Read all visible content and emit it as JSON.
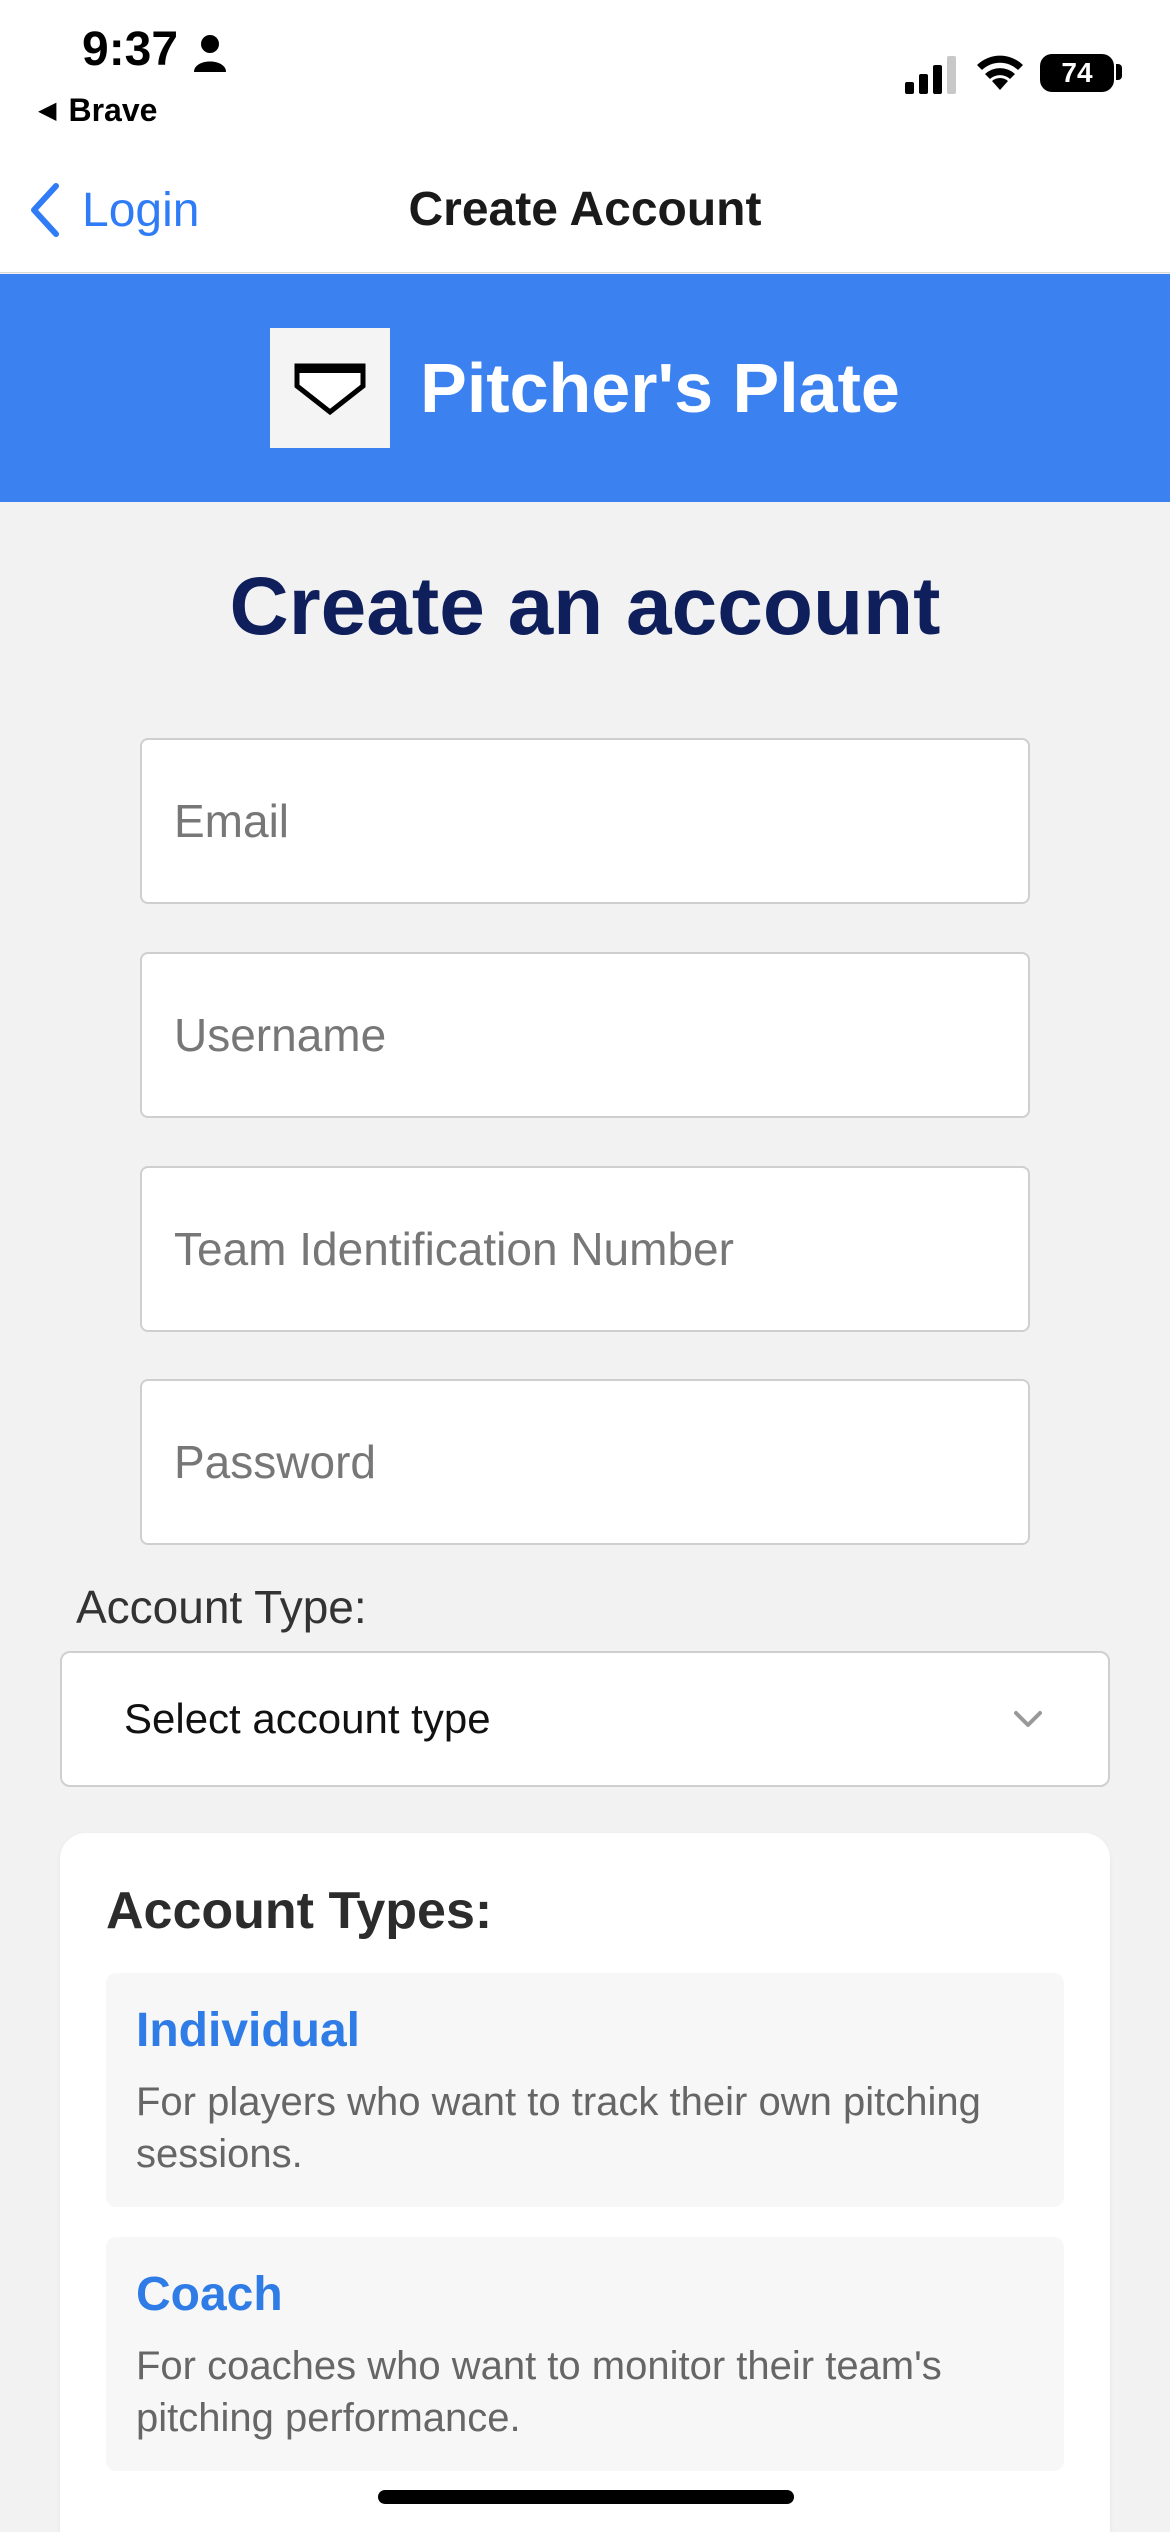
{
  "status_bar": {
    "time": "9:37",
    "back_app": "Brave",
    "battery": "74"
  },
  "nav": {
    "back_label": "Login",
    "title": "Create Account"
  },
  "banner": {
    "brand": "Pitcher's Plate",
    "background_color": "#3b82f0"
  },
  "form": {
    "heading": "Create an account",
    "email_placeholder": "Email",
    "username_placeholder": "Username",
    "team_placeholder": "Team Identification Number",
    "password_placeholder": "Password",
    "account_type_label": "Account Type:",
    "account_type_selected": "Select account type"
  },
  "account_types": {
    "title": "Account Types:",
    "items": [
      {
        "name": "Individual",
        "description": "For players who want to track their own pitching sessions."
      },
      {
        "name": "Coach",
        "description": "For coaches who want to monitor their team's pitching performance."
      }
    ]
  },
  "colors": {
    "accent": "#2f7cf6",
    "heading": "#0f1f5c"
  }
}
